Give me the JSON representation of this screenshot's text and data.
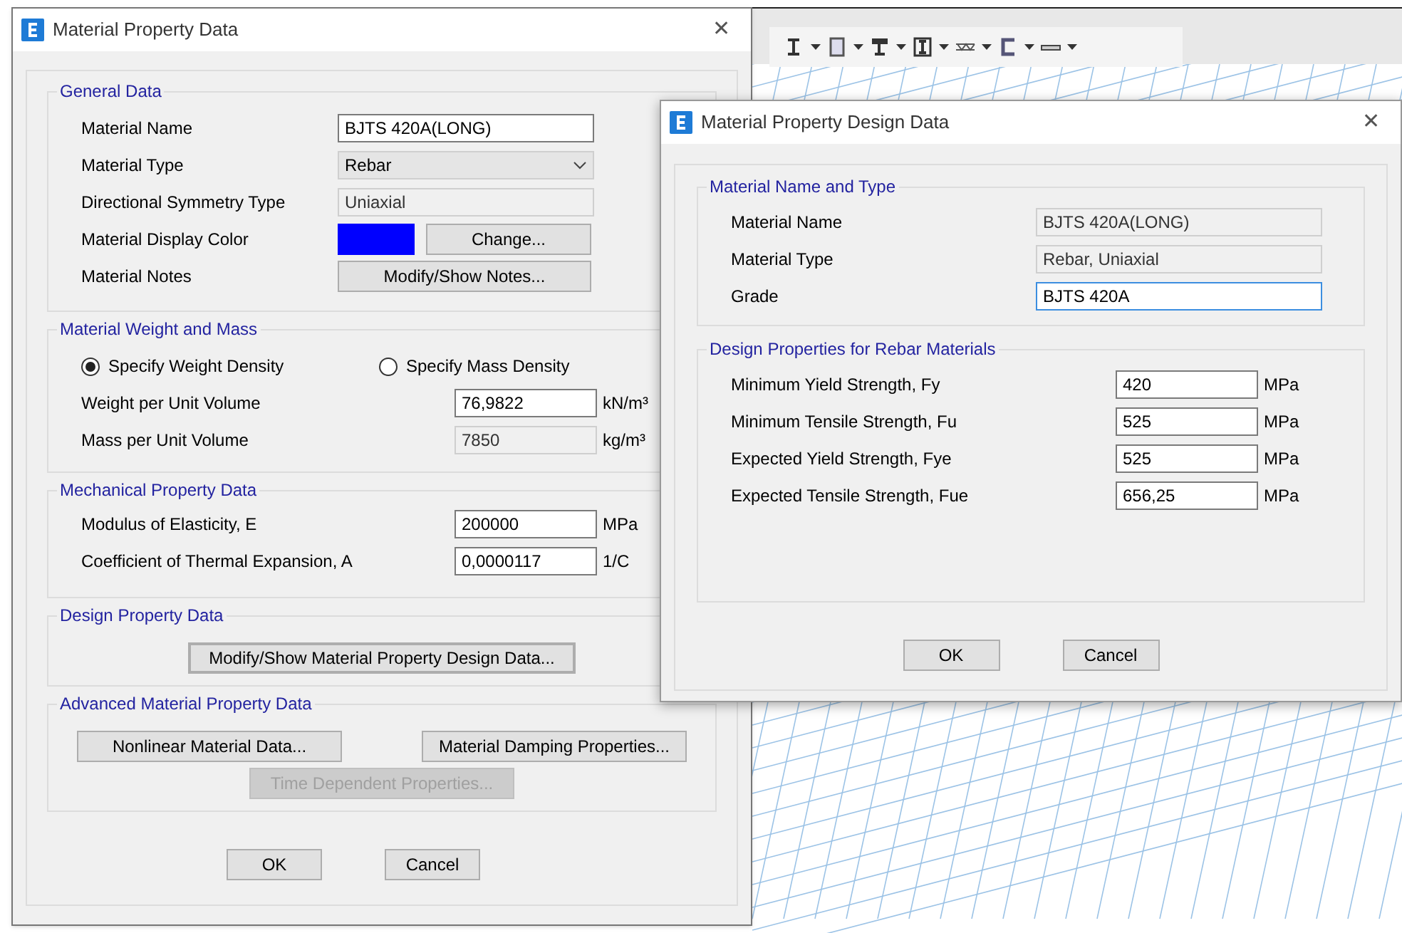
{
  "main_dialog": {
    "title": "Material Property Data",
    "close": "✕",
    "general": {
      "heading": "General Data",
      "rows": [
        {
          "kind": "text",
          "label": "Material Name",
          "value": "BJTS 420A(LONG)"
        },
        {
          "kind": "select",
          "label": "Material Type",
          "value": "Rebar"
        },
        {
          "kind": "readonly",
          "label": "Directional Symmetry Type",
          "value": "Uniaxial"
        },
        {
          "kind": "color",
          "label": "Material Display Color",
          "color": "#0000ff",
          "button": "Change..."
        },
        {
          "kind": "button",
          "label": "Material Notes",
          "button": "Modify/Show Notes..."
        }
      ]
    },
    "weight_mass": {
      "heading": "Material Weight and Mass",
      "options": [
        {
          "label": "Specify Weight Density",
          "selected": true
        },
        {
          "label": "Specify Mass Density",
          "selected": false
        }
      ],
      "rows": [
        {
          "label": "Weight per Unit Volume",
          "value": "76,9822",
          "unit": "kN/m³",
          "disabled": false
        },
        {
          "label": "Mass per Unit Volume",
          "value": "7850",
          "unit": "kg/m³",
          "disabled": true
        }
      ]
    },
    "mechanical": {
      "heading": "Mechanical Property Data",
      "rows": [
        {
          "label": "Modulus of Elasticity,  E",
          "value": "200000",
          "unit": "MPa",
          "disabled": false
        },
        {
          "label": "Coefficient of Thermal Expansion,  A",
          "value": "0,0000117",
          "unit": "1/C",
          "disabled": false
        }
      ]
    },
    "design": {
      "heading": "Design Property Data",
      "button": "Modify/Show Material Property Design Data..."
    },
    "advanced": {
      "heading": "Advanced Material Property Data",
      "buttons": [
        {
          "label": "Nonlinear Material Data...",
          "disabled": false
        },
        {
          "label": "Material Damping Properties...",
          "disabled": false
        },
        {
          "label": "Time Dependent Properties...",
          "disabled": true
        }
      ]
    },
    "buttons": [
      "OK",
      "Cancel"
    ]
  },
  "design_dialog": {
    "title": "Material Property Design Data",
    "close": "✕",
    "name_type": {
      "heading": "Material Name and Type",
      "rows": [
        {
          "label": "Material Name",
          "value": "BJTS 420A(LONG)",
          "disabled": true
        },
        {
          "label": "Material Type",
          "value": "Rebar, Uniaxial",
          "disabled": true
        },
        {
          "label": "Grade",
          "value": "BJTS 420A",
          "disabled": false
        }
      ]
    },
    "rebar": {
      "heading": "Design Properties for Rebar Materials",
      "rows": [
        {
          "label": "Minimum Yield Strength, Fy",
          "value": "420",
          "unit": "MPa"
        },
        {
          "label": "Minimum Tensile Strength, Fu",
          "value": "525",
          "unit": "MPa"
        },
        {
          "label": "Expected Yield Strength, Fye",
          "value": "525",
          "unit": "MPa"
        },
        {
          "label": "Expected Tensile Strength, Fue",
          "value": "656,25",
          "unit": "MPa"
        }
      ]
    },
    "buttons": [
      "OK",
      "Cancel"
    ]
  }
}
